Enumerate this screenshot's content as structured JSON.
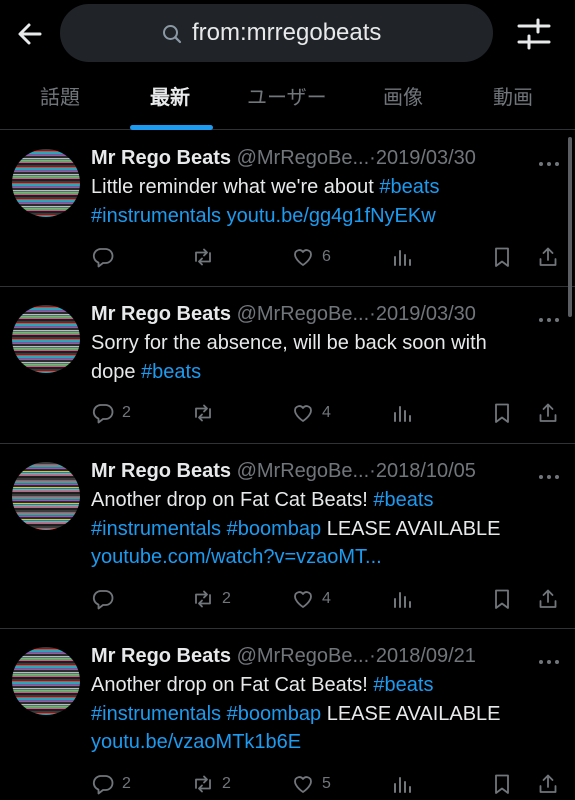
{
  "search": {
    "query": "from:mrregobeats"
  },
  "tabs": [
    {
      "label": "話題",
      "active": false
    },
    {
      "label": "最新",
      "active": true
    },
    {
      "label": "ユーザー",
      "active": false
    },
    {
      "label": "画像",
      "active": false
    },
    {
      "label": "動画",
      "active": false
    }
  ],
  "icons": {
    "back": "back-arrow-icon",
    "search": "search-icon",
    "filter": "filter-sliders-icon",
    "reply": "reply-icon",
    "retweet": "retweet-icon",
    "like": "heart-icon",
    "views": "views-icon",
    "bookmark": "bookmark-icon",
    "share": "share-icon",
    "more": "more-icon"
  },
  "colors": {
    "background": "#000000",
    "accent": "#1d9bf0",
    "muted": "#71767b",
    "text": "#e7e9ea"
  },
  "tweets": [
    {
      "name": "Mr Rego Beats",
      "handle": "@MrRegoBe...",
      "sep": "·",
      "date": "2019/03/30",
      "lines": [
        [
          {
            "t": "Little reminder what we're about ",
            "link": false
          },
          {
            "t": "#beats",
            "link": true
          }
        ],
        [
          {
            "t": "#instrumentals",
            "link": true
          },
          {
            "t": " ",
            "link": false
          },
          {
            "t": "youtu.be/gg4g1fNyEKw",
            "link": true
          }
        ]
      ],
      "counts": {
        "reply": "",
        "retweet": "",
        "like": "6"
      }
    },
    {
      "name": "Mr Rego Beats",
      "handle": "@MrRegoBe...",
      "sep": "·",
      "date": "2019/03/30",
      "lines": [
        [
          {
            "t": "Sorry for the absence, will be back soon with",
            "link": false
          }
        ],
        [
          {
            "t": "dope ",
            "link": false
          },
          {
            "t": "#beats",
            "link": true
          }
        ]
      ],
      "counts": {
        "reply": "2",
        "retweet": "",
        "like": "4"
      }
    },
    {
      "name": "Mr Rego Beats",
      "handle": "@MrRegoBe...",
      "sep": "·",
      "date": "2018/10/05",
      "lines": [
        [
          {
            "t": "Another drop on Fat Cat Beats! ",
            "link": false
          },
          {
            "t": "#beats",
            "link": true
          }
        ],
        [
          {
            "t": "#instrumentals",
            "link": true
          },
          {
            "t": " ",
            "link": false
          },
          {
            "t": "#boombap",
            "link": true
          },
          {
            "t": " LEASE AVAILABLE",
            "link": false
          }
        ],
        [
          {
            "t": "youtube.com/watch?v=vzaoMT...",
            "link": true
          }
        ]
      ],
      "counts": {
        "reply": "",
        "retweet": "2",
        "like": "4"
      }
    },
    {
      "name": "Mr Rego Beats",
      "handle": "@MrRegoBe...",
      "sep": "·",
      "date": "2018/09/21",
      "lines": [
        [
          {
            "t": "Another drop on Fat Cat Beats! ",
            "link": false
          },
          {
            "t": "#beats",
            "link": true
          }
        ],
        [
          {
            "t": "#instrumentals",
            "link": true
          },
          {
            "t": " ",
            "link": false
          },
          {
            "t": "#boombap",
            "link": true
          },
          {
            "t": " LEASE AVAILABLE",
            "link": false
          }
        ],
        [
          {
            "t": "youtu.be/vzaoMTk1b6E",
            "link": true
          }
        ]
      ],
      "counts": {
        "reply": "2",
        "retweet": "2",
        "like": "5"
      }
    }
  ]
}
